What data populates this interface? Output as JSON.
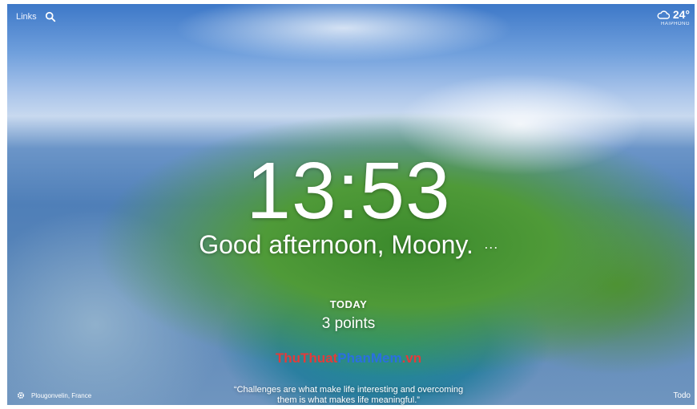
{
  "topbar": {
    "links_label": "Links",
    "search_icon": "search-icon"
  },
  "weather": {
    "icon": "cloud-icon",
    "temperature": "24°",
    "location": "HAIPHONG"
  },
  "clock": {
    "time": "13:53"
  },
  "greeting": {
    "text": "Good afternoon, Moony.",
    "more": "···"
  },
  "focus": {
    "label": "TODAY",
    "points": "3 points"
  },
  "watermark": {
    "part1": "ThuThuat",
    "part2": "PhanMem",
    "part3": ".vn"
  },
  "quote": {
    "line1": "“Challenges are what make life interesting and overcoming",
    "line2": "them is what makes life meaningful.”"
  },
  "footer": {
    "settings_icon": "gear-icon",
    "photo_location": "Plougonvelin, France",
    "todo_label": "Todo"
  }
}
